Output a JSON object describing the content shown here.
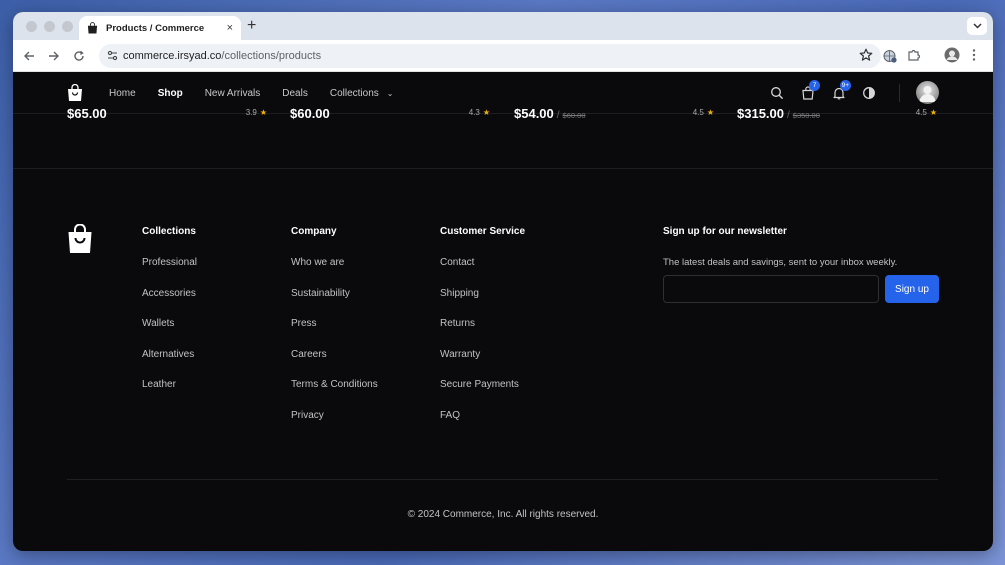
{
  "browser": {
    "tab_title": "Products / Commerce",
    "tab_close": "×",
    "new_tab": "+",
    "url_host": "commerce.irsyad.co",
    "url_path": "/collections/products"
  },
  "site": {
    "nav": {
      "home": "Home",
      "shop": "Shop",
      "new_arrivals": "New Arrivals",
      "deals": "Deals",
      "collections": "Collections"
    },
    "cart_badge": "7",
    "notifications_badge": "9+"
  },
  "products": [
    {
      "price": "$65.00",
      "original": "",
      "rating": "3.9"
    },
    {
      "price": "$60.00",
      "original": "",
      "rating": "4.3"
    },
    {
      "price": "$54.00",
      "original": "$60.00",
      "rating": "4.5"
    },
    {
      "price": "$315.00",
      "original": "$350.00",
      "rating": "4.5"
    }
  ],
  "footer": {
    "collections": {
      "heading": "Collections",
      "items": [
        "Professional",
        "Accessories",
        "Wallets",
        "Alternatives",
        "Leather"
      ]
    },
    "company": {
      "heading": "Company",
      "items": [
        "Who we are",
        "Sustainability",
        "Press",
        "Careers",
        "Terms & Conditions",
        "Privacy"
      ]
    },
    "customer_service": {
      "heading": "Customer Service",
      "items": [
        "Contact",
        "Shipping",
        "Returns",
        "Warranty",
        "Secure Payments",
        "FAQ"
      ]
    },
    "newsletter": {
      "heading": "Sign up for our newsletter",
      "description": "The latest deals and savings, sent to your inbox weekly.",
      "email_value": "",
      "button": "Sign up"
    },
    "copyright": "© 2024 Commerce, Inc. All rights reserved."
  },
  "colors": {
    "accent": "#2563eb",
    "star": "#f5b301",
    "background": "#0a0a0c"
  }
}
